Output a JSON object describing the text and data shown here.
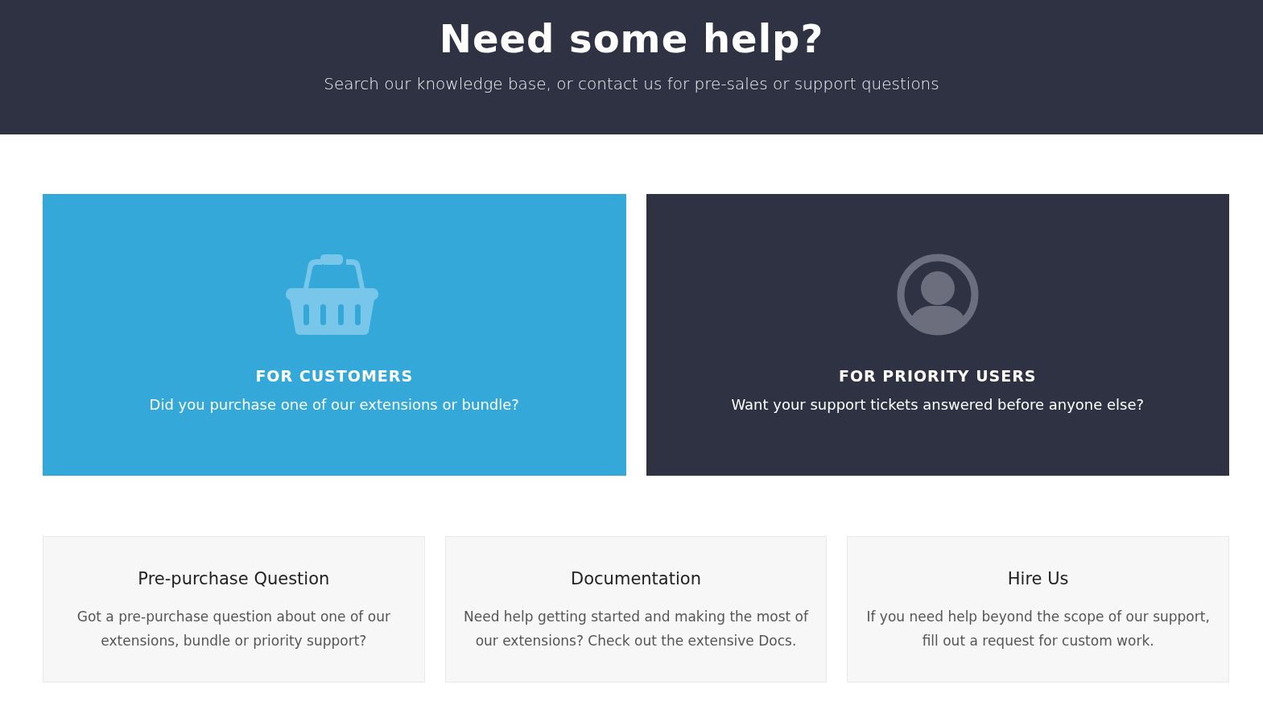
{
  "header": {
    "title": "Need some help?",
    "subtitle": "Search our knowledge base, or contact us for pre-sales or support questions"
  },
  "audience_cards": [
    {
      "kind": "customers",
      "title": "FOR CUSTOMERS",
      "text": "Did you purchase one of our extensions or bundle?"
    },
    {
      "kind": "priority",
      "title": "FOR PRIORITY USERS",
      "text": "Want your support tickets answered before anyone else?"
    }
  ],
  "info_cards": [
    {
      "title": "Pre-purchase Question",
      "text": "Got a pre-purchase question about one of our extensions, bundle or priority support?"
    },
    {
      "title": "Documentation",
      "text": "Need help getting started and making the most of our extensions? Check out the extensive Docs."
    },
    {
      "title": "Hire Us",
      "text": "If you need help beyond the scope of our support, fill out a request for custom work."
    }
  ]
}
